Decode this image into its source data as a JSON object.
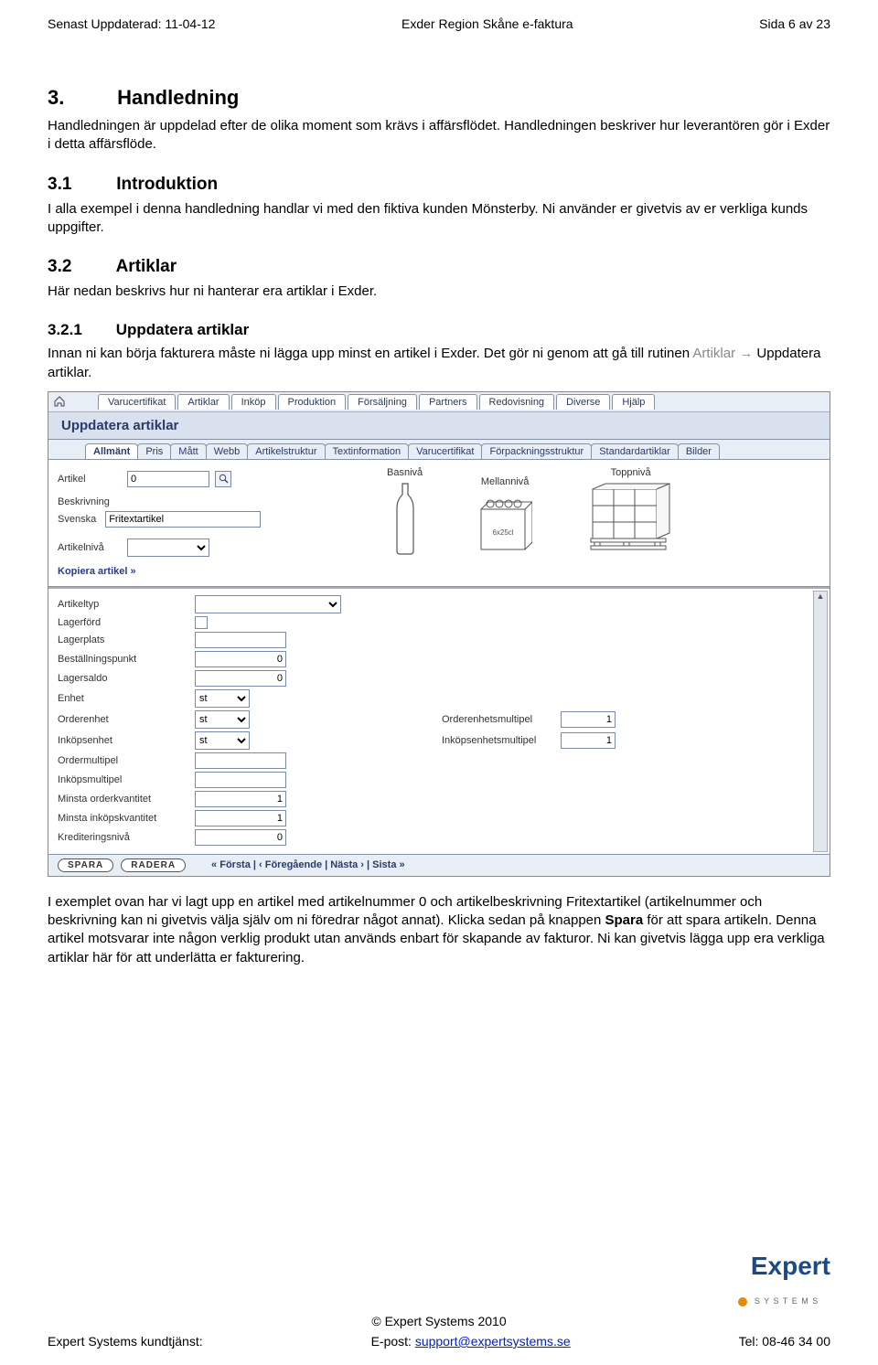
{
  "header": {
    "left": "Senast Uppdaterad: 11-04-12",
    "center": "Exder Region Skåne e-faktura",
    "right": "Sida 6 av 23"
  },
  "sec3": {
    "num": "3.",
    "title": "Handledning",
    "p1": "Handledningen är uppdelad efter de olika moment som krävs i affärsflödet. Handledningen beskriver hur leverantören gör i Exder i detta affärsflöde."
  },
  "sec31": {
    "num": "3.1",
    "title": "Introduktion",
    "p1": "I alla exempel i denna handledning handlar vi med den fiktiva kunden Mönsterby. Ni använder er givetvis av er verkliga kunds uppgifter."
  },
  "sec32": {
    "num": "3.2",
    "title": "Artiklar",
    "p1": "Här nedan beskrivs hur ni hanterar era artiklar i Exder."
  },
  "sec321": {
    "num": "3.2.1",
    "title": "Uppdatera artiklar",
    "p1a": "Innan ni kan börja fakturera måste ni lägga upp minst en artikel i Exder. Det gör ni genom att gå till rutinen ",
    "p1b": "Artiklar",
    "p1c": " Uppdatera artiklar."
  },
  "app": {
    "menu": [
      "Varucertifikat",
      "Artiklar",
      "Inköp",
      "Produktion",
      "Försäljning",
      "Partners",
      "Redovisning",
      "Diverse",
      "Hjälp"
    ],
    "title": "Uppdatera artiklar",
    "subtabs": [
      "Allmänt",
      "Pris",
      "Mått",
      "Webb",
      "Artikelstruktur",
      "Textinformation",
      "Varucertifikat",
      "Förpackningsstruktur",
      "Standardartiklar",
      "Bilder"
    ],
    "artikel_lbl": "Artikel",
    "artikel_val": "0",
    "levels": [
      "Basnivå",
      "Mellannivå",
      "Toppnivå"
    ],
    "beskrivning_lbl": "Beskrivning",
    "lang": "Svenska",
    "beskrivning_val": "Fritextartikel",
    "artikelniva_lbl": "Artikelnivå",
    "kopiera": "Kopiera artikel »",
    "grid": {
      "artikeltyp": "Artikeltyp",
      "lagerford": "Lagerförd",
      "lagerplats": "Lagerplats",
      "bestallningspunkt": "Beställningspunkt",
      "bestallningspunkt_v": "0",
      "lagersaldo": "Lagersaldo",
      "lagersaldo_v": "0",
      "enhet": "Enhet",
      "enhet_v": "st",
      "orderenhet": "Orderenhet",
      "orderenhet_v": "st",
      "orderenhetsmultipel": "Orderenhetsmultipel",
      "orderenhetsmultipel_v": "1",
      "inkopenhet": "Inköpsenhet",
      "inkopenhet_v": "st",
      "inkopenhetsmultipel": "Inköpsenhetsmultipel",
      "inkopenhetsmultipel_v": "1",
      "ordermultipel": "Ordermultipel",
      "inkopsmultipel": "Inköpsmultipel",
      "minsta_order": "Minsta orderkvantitet",
      "minsta_order_v": "1",
      "minsta_inkop": "Minsta inköpskvantitet",
      "minsta_inkop_v": "1",
      "kreditniva": "Krediteringsnivå",
      "kreditniva_v": "0"
    },
    "spara": "SPARA",
    "radera": "RADERA",
    "pager": "«  Första  |  ‹  Föregående  |  Nästa  ›  |  Sista  »"
  },
  "after_p": "I exemplet ovan har vi lagt upp en artikel med artikelnummer 0 och artikelbeskrivning Fritextartikel (artikelnummer och beskrivning kan ni givetvis välja själv om ni föredrar något annat). Klicka sedan på knappen Spara för att spara artikeln. Denna artikel motsvarar inte någon verklig produkt utan används enbart för skapande av fakturor. Ni kan givetvis lägga upp era verkliga artiklar här för att underlätta er fakturering.",
  "footer": {
    "copy": "© Expert Systems 2010",
    "left": "Expert Systems kundtjänst:",
    "mid_label": "E-post: ",
    "mid_link": "support@expertsystems.se",
    "right": "Tel: 08-46 34 00"
  },
  "logo": {
    "text": "Expert",
    "sub": "S Y S T E M S"
  }
}
